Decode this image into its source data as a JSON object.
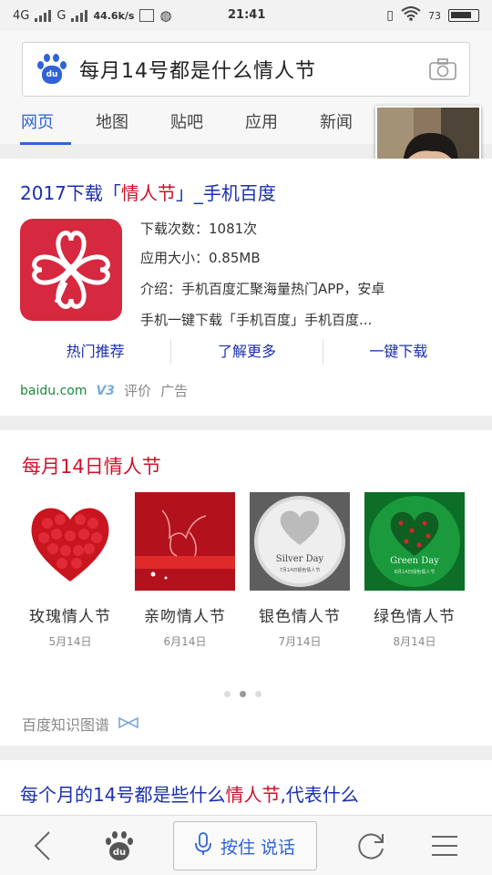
{
  "status_bar": {
    "network1": "4G",
    "network2": "G",
    "speed": "44.6k/s",
    "time": "21:41",
    "battery": "73"
  },
  "search": {
    "query": "每月14号都是什么情人节"
  },
  "tabs": [
    {
      "label": "网页",
      "active": true
    },
    {
      "label": "地图",
      "active": false
    },
    {
      "label": "贴吧",
      "active": false
    },
    {
      "label": "应用",
      "active": false
    },
    {
      "label": "新闻",
      "active": false
    }
  ],
  "app_result": {
    "title_prefix": "2017下载「",
    "title_highlight": "情人节",
    "title_suffix": "」_手机百度",
    "downloads": "下载次数：1081次",
    "size": "应用大小：0.85MB",
    "intro_line1": "介绍：手机百度汇聚海量热门APP，安卓",
    "intro_line2": "手机一键下载「手机百度」手机百度...",
    "actions": [
      "热门推荐",
      "了解更多",
      "一键下载"
    ],
    "source": "baidu.com",
    "badge": "V3",
    "review": "评价",
    "ad": "广告",
    "icon_color": "#d6283e"
  },
  "knowledge": {
    "title": "每月14日情人节",
    "items": [
      {
        "name": "玫瑰情人节",
        "date": "5月14日"
      },
      {
        "name": "亲吻情人节",
        "date": "6月14日"
      },
      {
        "name": "银色情人节",
        "date": "7月14日",
        "img_text": "Silver Day",
        "img_sub": "7月14日银色情人节"
      },
      {
        "name": "绿色情人节",
        "date": "8月14日",
        "img_text": "Green Day",
        "img_sub": "8月14日绿色情人节"
      }
    ],
    "footer": "百度知识图谱"
  },
  "result3": {
    "title_prefix": "每个月的14号都是些什么",
    "title_highlight": "情人节",
    "title_suffix": ",代表什么"
  },
  "bottom_bar": {
    "voice_label": "按住 说话"
  },
  "colors": {
    "accent": "#2f63d6",
    "link": "#1a2fb0",
    "highlight": "#d0102a",
    "source_green": "#1a8a3a"
  }
}
